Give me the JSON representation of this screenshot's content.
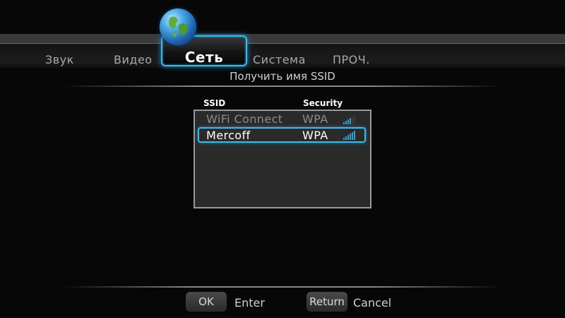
{
  "menu": {
    "tabs": [
      {
        "label": "Звук"
      },
      {
        "label": "Видео"
      },
      {
        "label": "Сеть"
      },
      {
        "label": "Система"
      },
      {
        "label": "ПРОЧ."
      }
    ],
    "active_tab": "Сеть",
    "active_icon": "globe-icon"
  },
  "page": {
    "subtitle": "Получить имя SSID"
  },
  "ssid_list": {
    "columns": [
      "SSID",
      "Security"
    ],
    "rows": [
      {
        "ssid": "WiFi Connect",
        "security": "WPA",
        "signal_icon": "signal-strength-icon",
        "signal_level": 0.6
      },
      {
        "ssid": "Mercoff",
        "security": "WPA",
        "signal_icon": "signal-strength-icon",
        "signal_level": 1.0,
        "selected": true
      }
    ]
  },
  "footer": {
    "ok_button": "OK",
    "ok_action": "Enter",
    "return_button": "Return",
    "return_action": "Cancel"
  },
  "colors": {
    "accent": "#3fb7e8",
    "background": "#070707"
  }
}
